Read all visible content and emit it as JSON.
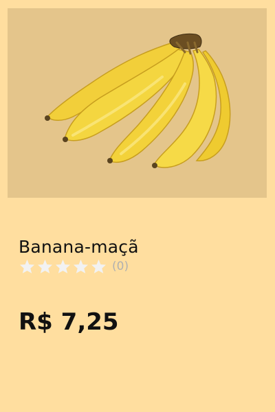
{
  "product": {
    "image_icon": "banana-bunch",
    "image_background": "#E4C58B",
    "name": "Banana-maçã",
    "rating": {
      "stars_total": 5,
      "stars_filled": 0,
      "count_text": "(0)",
      "star_color": "#F2F2F2"
    },
    "price": "R$ 7,25"
  },
  "colors": {
    "background": "#FFDE9F",
    "text": "#111111",
    "muted": "#B0B0B0"
  }
}
